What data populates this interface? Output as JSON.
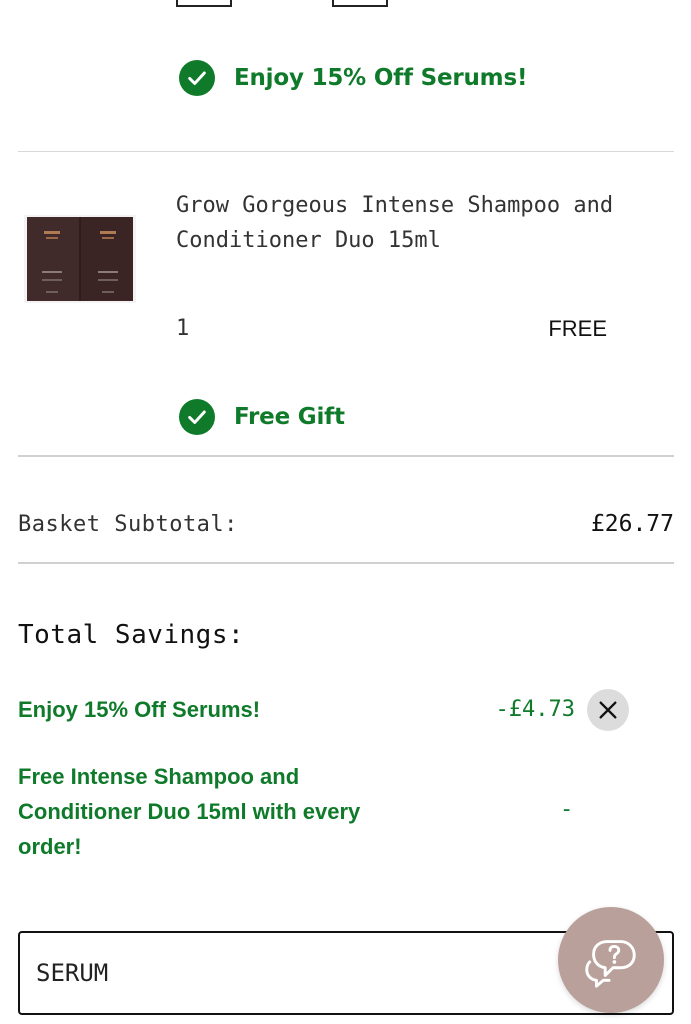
{
  "top_promo": {
    "text": "Enjoy 15% Off Serums!"
  },
  "product": {
    "name": "Grow Gorgeous Intense Shampoo and Conditioner Duo 15ml",
    "quantity": "1",
    "price": "FREE",
    "badge": "Free Gift"
  },
  "basket": {
    "subtotal_label": "Basket Subtotal:",
    "subtotal_value": "£26.77"
  },
  "savings": {
    "heading": "Total Savings:",
    "items": [
      {
        "label": "Enjoy 15% Off Serums!",
        "value": "-£4.73",
        "removable": true
      },
      {
        "label": "Free Intense Shampoo and Conditioner Duo 15ml with every order!",
        "value": "-",
        "removable": false
      }
    ]
  },
  "promo_code": {
    "value": "SERUM"
  },
  "icons": {
    "check": "check-circle-icon",
    "remove": "close-icon",
    "help": "help-chat-icon"
  },
  "colors": {
    "accent_green": "#0f7a2a",
    "help_button": "#b9a09a"
  }
}
